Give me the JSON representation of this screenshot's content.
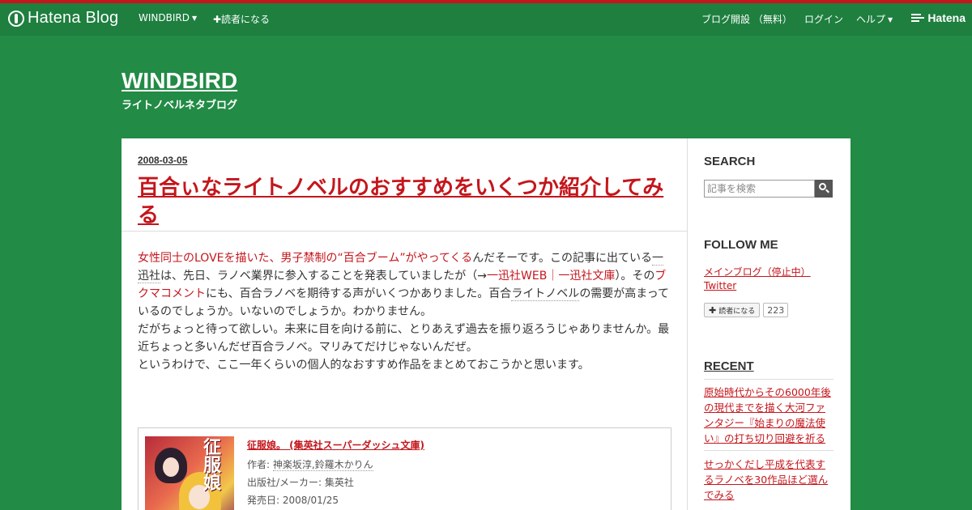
{
  "topbar": {
    "logo_text": "Hatena Blog",
    "blog_menu": "WINDBIRD",
    "subscribe": "✚読者になる",
    "create_blog": "ブログ開設 （無料）",
    "login": "ログイン",
    "help": "ヘルプ",
    "brand": "Hatena"
  },
  "blog": {
    "title": "WINDBIRD",
    "description": "ライトノベルネタブログ"
  },
  "entry": {
    "date": "2008-03-05",
    "title": "百合ぃなライトノベルのおすすめをいくつか紹介してみる",
    "p1_link1": "女性同士のLOVEを描いた、男子禁制の“百合ブーム”がやってくる",
    "p1_t1": "んだそーです。この記事に出ている",
    "p1_kw1": "一迅社",
    "p1_t2": "は、先日、ラノベ業界に参入することを発表していましたが（→",
    "p1_link2": "一迅社WEB｜一迅社文庫",
    "p1_t3": "）。その",
    "p1_link3": "ブクマコメント",
    "p1_t4": "にも、百合ラノベを期待する声がいくつかありました。百合",
    "p1_kw2": "ライトノベル",
    "p1_t5": "の需要が高まっているのでしょうか。いないのでしょうか。わかりません。",
    "p2": "だがちょっと待って欲しい。未来に目を向ける前に、とりあえず過去を振り返ろうじゃありませんか。最近ちょっと多いんだぜ百合ラノベ。マリみてだけじゃないんだぜ。",
    "p3": "というわけで、ここ一年くらいの個人的なおすすめ作品をまとめておこうかと思います。"
  },
  "product": {
    "cover_text": "征服娘",
    "title": "征服娘。 (集英社スーパーダッシュ文庫)",
    "author_label": "作者: ",
    "author": "神楽坂淳,鈴羅木かりん",
    "publisher_label": "出版社/メーカー: ",
    "publisher": "集英社",
    "release_label": "発売日: ",
    "release": "2008/01/25"
  },
  "sidebar": {
    "search_heading": "SEARCH",
    "search_placeholder": "記事を検索",
    "follow_heading": "FOLLOW ME",
    "main_blog_link": "メインブログ（停止中）",
    "twitter_link": "Twitter",
    "subscribe_label": "読者になる",
    "subscriber_count": "223",
    "recent_heading": "RECENT",
    "recent": [
      "原始時代からその6000年後の現代までを描く大河ファンタジー『始まりの魔法使い』の打ち切り回避を祈る",
      "せっかくだし平成を代表するラノベを30作品ほど選んでみる"
    ]
  },
  "colors": {
    "background": "#228b45",
    "topbar": "#1e7f3f",
    "accent_red": "#c4161c"
  }
}
